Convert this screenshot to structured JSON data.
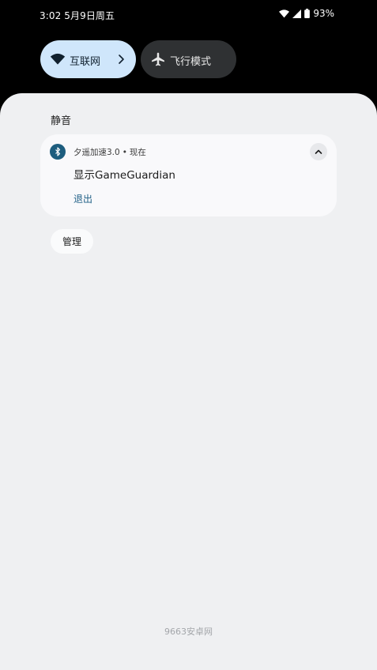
{
  "status_bar": {
    "time_date": "3:02 5月9日周五",
    "battery_percent": "93%"
  },
  "quick_settings": {
    "tiles": [
      {
        "label": "互联网",
        "icon": "wifi-icon",
        "has_chevron": true,
        "color": "#cfe6fb"
      },
      {
        "label": "飞行模式",
        "icon": "airplane-icon",
        "has_chevron": false,
        "color": "#2f3133"
      }
    ]
  },
  "notifications": {
    "section_title": "静音",
    "items": [
      {
        "app_name": "夕遥加速3.0",
        "separator": "•",
        "time": "现在",
        "title": "显示GameGuardian",
        "action": "退出",
        "icon": "app-bluetooth-icon",
        "icon_color": "#1d5d7e"
      }
    ],
    "manage_label": "管理"
  },
  "watermark": "9663安卓网",
  "colors": {
    "shade_bg": "#eff0f2",
    "card_bg": "#f9f9fb",
    "accent_link": "#1f5f86"
  }
}
